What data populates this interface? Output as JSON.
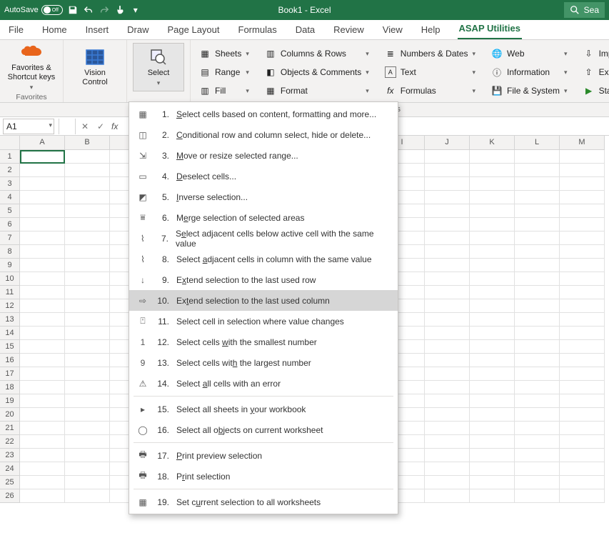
{
  "titlebar": {
    "autosave_label": "AutoSave",
    "autosave_state": "Off",
    "title": "Book1  -  Excel",
    "search_label": "Sea"
  },
  "tabs": {
    "file": "File",
    "home": "Home",
    "insert": "Insert",
    "draw": "Draw",
    "pagelayout": "Page Layout",
    "formulas": "Formulas",
    "data": "Data",
    "review": "Review",
    "view": "View",
    "help": "Help",
    "asap": "ASAP Utilities"
  },
  "ribbon": {
    "favorites_btn": "Favorites &\nShortcut keys",
    "favorites_group": "Favorites",
    "vision_btn": "Vision\nControl",
    "select_btn": "Select",
    "col1": {
      "sheets": "Sheets",
      "range": "Range",
      "fill": "Fill"
    },
    "col2": {
      "colsrows": "Columns & Rows",
      "objects": "Objects & Comments",
      "format": "Format"
    },
    "col3": {
      "numbers": "Numbers & Dates",
      "text": "Text",
      "formulas": "Formulas"
    },
    "col4": {
      "web": "Web",
      "info": "Information",
      "filesys": "File & System"
    },
    "col5": {
      "import": "Import",
      "export": "Export",
      "start": "Start"
    },
    "tools_label": "ls"
  },
  "namebox": "A1",
  "columns": [
    "A",
    "B",
    "",
    "",
    "",
    "",
    "",
    "",
    "I",
    "J",
    "K",
    "L",
    "M"
  ],
  "rowcount": 26,
  "menu": {
    "items": [
      {
        "n": "1.",
        "t": "Select cells based on content, formatting and more...",
        "u": "S"
      },
      {
        "n": "2.",
        "t": "Conditional row and column select, hide or delete...",
        "u": "C"
      },
      {
        "n": "3.",
        "t": "Move or resize selected range...",
        "u": "M"
      },
      {
        "n": "4.",
        "t": "Deselect cells...",
        "u": "D"
      },
      {
        "n": "5.",
        "t": "Inverse selection...",
        "u": "I"
      },
      {
        "n": "6.",
        "t": "Merge selection of selected areas",
        "u": "e",
        "pre": "M"
      },
      {
        "n": "7.",
        "t": "Select adjacent cells below active cell with the same value",
        "u": "e",
        "pre": "S"
      },
      {
        "n": "8.",
        "t": "Select adjacent cells in column with the same value",
        "u": "a",
        "pre": "Select "
      },
      {
        "n": "9.",
        "t": "Extend selection to the last used row",
        "u": "x",
        "pre": "E"
      },
      {
        "n": "10.",
        "t": "Extend selection to the last used column",
        "u": "t",
        "pre": "Ex",
        "hover": true
      },
      {
        "n": "11.",
        "t": "Select cell in selection where value changes",
        "u": ""
      },
      {
        "n": "12.",
        "t": "Select cells with the smallest number",
        "u": "w",
        "pre": "Select cells "
      },
      {
        "n": "13.",
        "t": "Select cells with the largest number",
        "u": "h",
        "pre": "Select cells wit"
      },
      {
        "n": "14.",
        "t": "Select all cells with an error",
        "u": "a",
        "pre": "Select "
      },
      {
        "sep": true
      },
      {
        "n": "15.",
        "t": "Select all sheets in your workbook",
        "u": "y",
        "pre": "Select all sheets in "
      },
      {
        "n": "16.",
        "t": "Select all objects on current worksheet",
        "u": "b",
        "pre": "Select all o"
      },
      {
        "sep": true
      },
      {
        "n": "17.",
        "t": "Print preview selection",
        "u": "P"
      },
      {
        "n": "18.",
        "t": "Print selection",
        "u": "r",
        "pre": "P"
      },
      {
        "sep": true
      },
      {
        "n": "19.",
        "t": "Set current selection to all worksheets",
        "u": "u",
        "pre": "Set c"
      }
    ]
  }
}
